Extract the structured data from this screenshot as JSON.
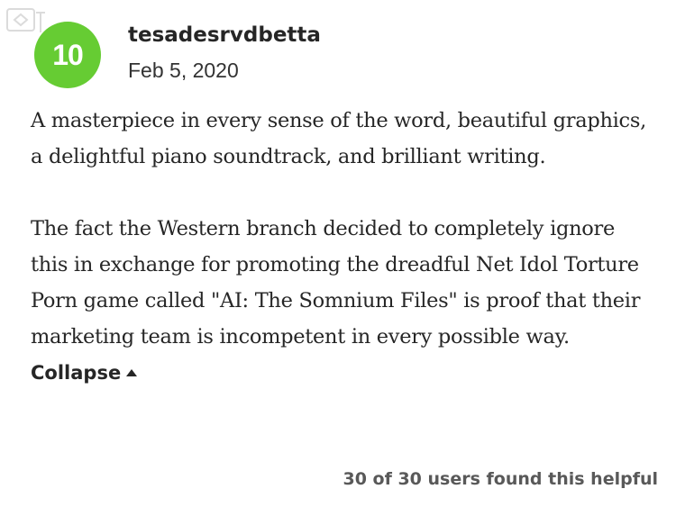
{
  "review": {
    "score": "10",
    "score_color": "#66cc33",
    "username": "tesadesrvdbetta",
    "date": "Feb 5, 2020",
    "paragraphs": [
      "A masterpiece in every sense of the word, beautiful graphics, a delightful piano soundtrack, and brilliant writing.",
      "The fact the Western branch decided to completely ignore this in exchange for promoting the dreadful Net Idol Torture Porn game called \"AI: The Somnium Files\" is proof that their marketing team is incompetent in every possible way."
    ],
    "collapse_label": "Collapse",
    "collapse_icon": "caret-up-icon",
    "helpful_text": "30 of 30 users found this helpful"
  },
  "watermark_icon": "watermark-logo-icon"
}
